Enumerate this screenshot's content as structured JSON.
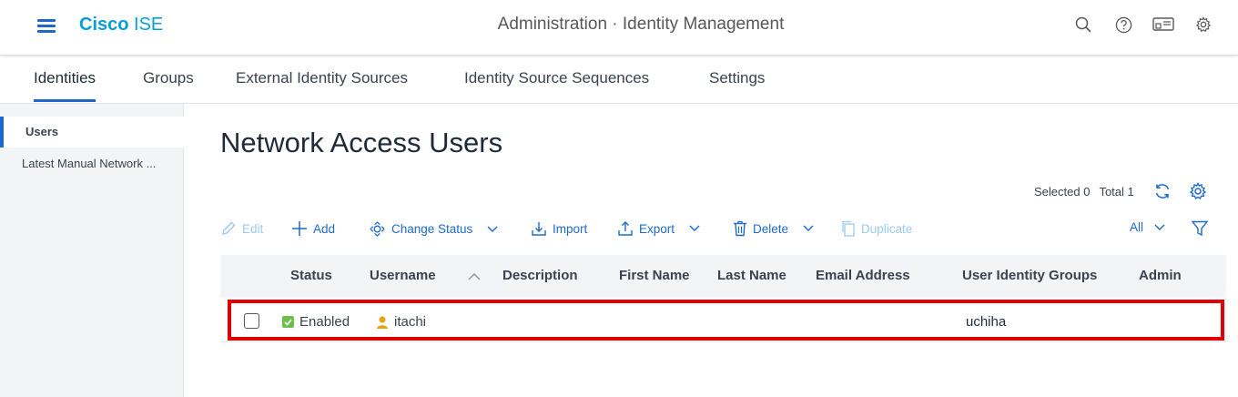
{
  "header": {
    "brand_bold": "Cisco",
    "brand_product": "ISE",
    "context_title": "Administration · Identity Management"
  },
  "icons": {
    "menu": "hamburger-menu-icon",
    "search": "search-icon",
    "help": "help-icon",
    "notifications": "notifications-icon",
    "settings": "gear-icon"
  },
  "tabs": [
    {
      "label": "Identities",
      "active": true
    },
    {
      "label": "Groups"
    },
    {
      "label": "External Identity Sources"
    },
    {
      "label": "Identity Source Sequences"
    },
    {
      "label": "Settings"
    }
  ],
  "sidebar": {
    "items": [
      {
        "label": "Users",
        "active": true
      },
      {
        "label": "Latest Manual Network ..."
      }
    ]
  },
  "main": {
    "title": "Network Access Users",
    "selected_label": "Selected 0",
    "total_label": "Total 1",
    "filter_select": "All"
  },
  "toolbar": {
    "edit": "Edit",
    "add": "Add",
    "change_status": "Change Status",
    "import": "Import",
    "export": "Export",
    "delete": "Delete",
    "duplicate": "Duplicate"
  },
  "table": {
    "columns": [
      "Status",
      "Username",
      "Description",
      "First Name",
      "Last Name",
      "Email Address",
      "User Identity Groups",
      "Admin"
    ],
    "rows": [
      {
        "status": "Enabled",
        "username": "itachi",
        "description": "",
        "first_name": "",
        "last_name": "",
        "email": "",
        "groups": "uchiha",
        "admin": ""
      }
    ]
  },
  "colors": {
    "accent": "#1d69cc",
    "brand": "#049fd9",
    "enabled": "#6cc04a",
    "highlight": "#e00000"
  }
}
